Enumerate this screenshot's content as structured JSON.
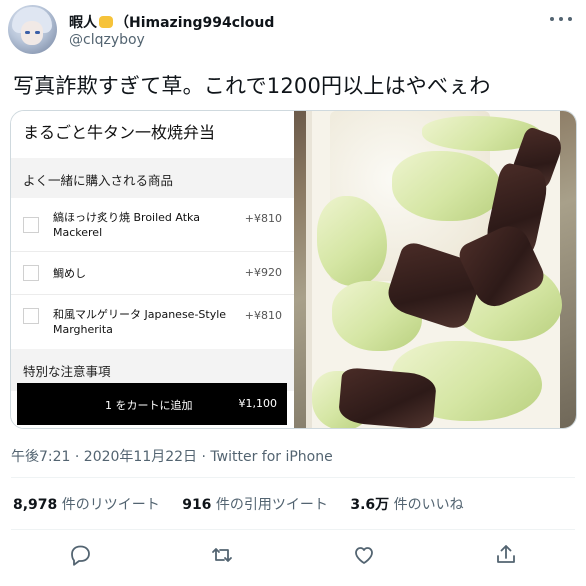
{
  "author": {
    "display_name_before_emoji": "暇人",
    "display_name_after_emoji": "（Himazing994cloud",
    "handle": "@clqzyboy",
    "avatar_icon": "avatar-icon",
    "emoji_icon": "fist-icon"
  },
  "tweet": {
    "text": "写真詐欺すぎて草。これで1200円以上はやべぇわ"
  },
  "menu_screenshot": {
    "title": "まるごと牛タン一枚焼弁当",
    "frequently_bought_label": "よく一緒に購入される商品",
    "items": [
      {
        "name": "縞ほっけ炙り焼 Broiled Atka Mackerel",
        "price": "+¥810"
      },
      {
        "name": "鯛めし",
        "price": "+¥920"
      },
      {
        "name": "和風マルゲリータ Japanese-Style Margherita",
        "price": "+¥810"
      }
    ],
    "special_instructions_label": "特別な注意事項",
    "cart_button_label": "1 をカートに追加",
    "cart_button_price": "¥1,100"
  },
  "meta": {
    "timestamp": "午後7:21 · 2020年11月22日 · Twitter for iPhone"
  },
  "stats": {
    "retweets_count": "8,978",
    "retweets_label": "件のリツイート",
    "quotes_count": "916",
    "quotes_label": "件の引用ツイート",
    "likes_count": "3.6万",
    "likes_label": "件のいいね"
  },
  "colors": {
    "text_primary": "#0f1419",
    "text_secondary": "#536471",
    "border": "#eff3f4"
  },
  "action_icons": [
    "reply-icon",
    "retweet-icon",
    "like-icon",
    "share-icon"
  ]
}
